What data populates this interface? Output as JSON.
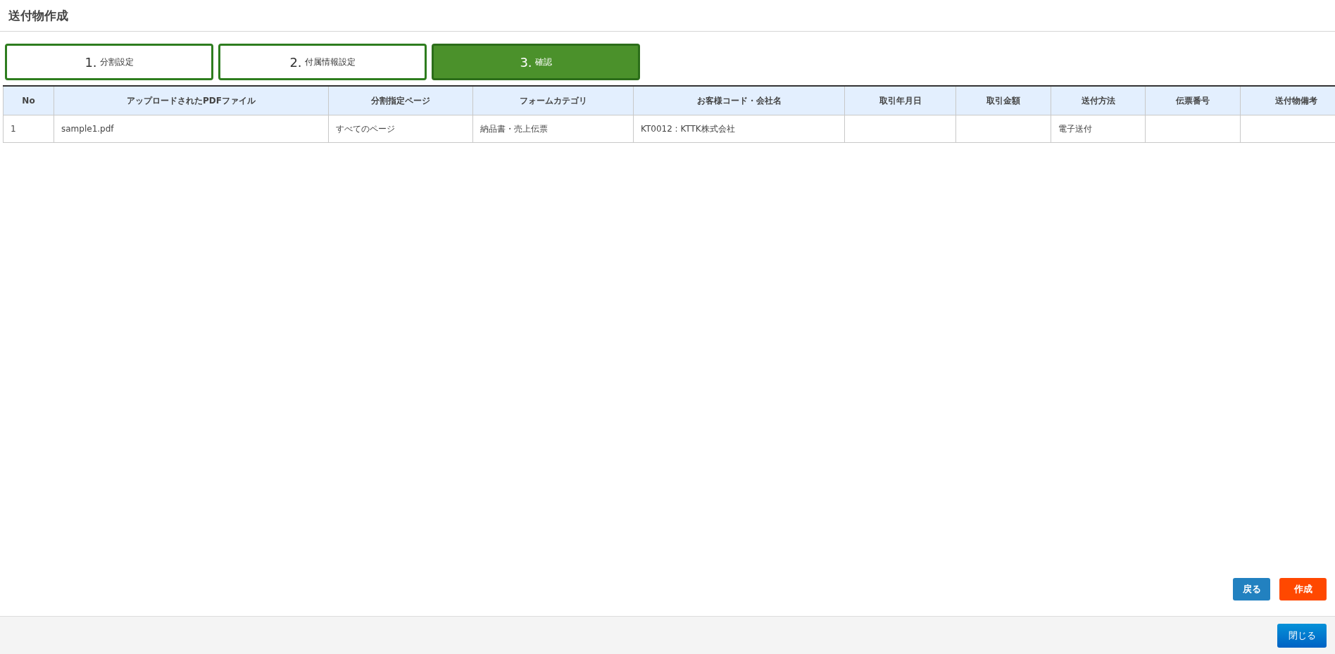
{
  "window": {
    "title": "送付物作成"
  },
  "steps": [
    {
      "number": "1.",
      "label": "分割設定",
      "selected": false
    },
    {
      "number": "2.",
      "label": "付属情報設定",
      "selected": false
    },
    {
      "number": "3.",
      "label": "確認",
      "selected": true
    }
  ],
  "table": {
    "columns": [
      "No",
      "アップロードされたPDFファイル",
      "分割指定ページ",
      "フォームカテゴリ",
      "お客様コード・会社名",
      "取引年月日",
      "取引金額",
      "送付方法",
      "伝票番号",
      "送付物備考"
    ],
    "rows": [
      [
        "1",
        "sample1.pdf",
        "すべてのページ",
        "納品書・売上伝票",
        "KT0012 : KTTK株式会社",
        "",
        "",
        "電子送付",
        "",
        ""
      ]
    ]
  },
  "actions": [
    {
      "label": "戻る",
      "kind": "back"
    },
    {
      "label": "作成",
      "kind": "create"
    }
  ],
  "footer": {
    "buttons": [
      {
        "label": "閉じる",
        "kind": "close"
      }
    ]
  }
}
